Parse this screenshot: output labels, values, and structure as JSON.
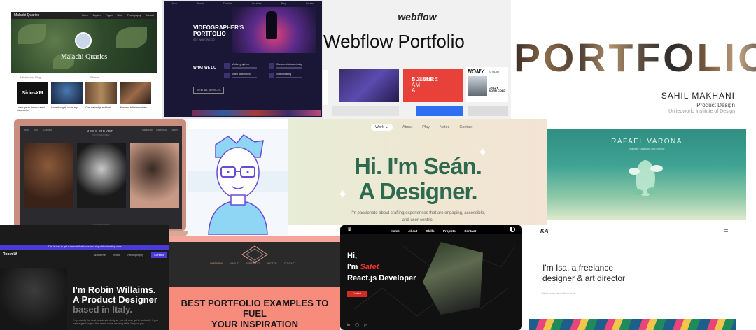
{
  "malachi": {
    "site_name": "Malachi Quaries",
    "nav_links": [
      "Home",
      "Explore",
      "Pages",
      "Work",
      "Photography",
      "Contact"
    ],
    "hero_name": "Malachi Quaries",
    "sub_tabs": [
      "Articles and Vlog",
      "Photos"
    ],
    "thumb_labels": [
      "SiriusXM",
      "",
      "",
      ""
    ],
    "captions": [
      "Lorem ipsum dolor sit amet consectetur",
      "Some thoughts on the trip",
      "Over the bridge and back",
      "Weekend in the mountains"
    ]
  },
  "videographer": {
    "nav_links": [
      "Home",
      "About",
      "Portfolio",
      "Services",
      "Blog",
      "Contact"
    ],
    "title_line1": "VIDEOGRAPHER'S",
    "title_line2": "PORTFOLIO",
    "subtitle": "SEE WHAT WE DO",
    "section": "WHAT WE DO",
    "button": "VIEW ALL SERVICES",
    "services": [
      "Motion graphics",
      "Commercial advertising",
      "Video distribution",
      "Video hosting"
    ]
  },
  "webflow": {
    "logo": "webflow",
    "title": "Webflow Portfolio",
    "shot_text": [
      "I AM A",
      "SIXIMLE",
      "BULSHRE"
    ],
    "brand": "NOMY",
    "brand_suffix": "STUDIO",
    "crazy": [
      "CRAZY",
      "BORN COLD"
    ]
  },
  "sahil": {
    "headline": "PORTFOLIO",
    "name": "SAHIL MAKHANI",
    "role": "Product Design",
    "school": "Unitedworld Institute of Design"
  },
  "jess": {
    "nav_links": [
      "Work",
      "Info",
      "Contact"
    ],
    "name": "JESS MEYER",
    "tagline": "PHOTOGRAPHER",
    "social": [
      "Instagram",
      "Facebook",
      "Twitter"
    ],
    "footer": "© 2024 Jess Meyer"
  },
  "sean": {
    "nav": [
      "Work",
      "About",
      "Play",
      "Notes",
      "Contact"
    ],
    "headline_1": "Hi. I'm Seán.",
    "headline_2": "A Designer.",
    "sub_1": "I'm passionate about crafting experiences that are engaging, accessible,",
    "sub_2": "and user-centric."
  },
  "rafael": {
    "name": "RAFAEL VARONA",
    "subtitle": "Illustrator | Animator | Art Director"
  },
  "robin": {
    "banner": "This is how to get a website that looks amazing without writing code",
    "logo": "Robin.W",
    "nav_links": [
      "About me",
      "Work",
      "Photography"
    ],
    "contact": "Contact",
    "headline_1": "I'm Robin Willaims.",
    "headline_2": "A Product Designer",
    "headline_3": "based in Italy.",
    "para": "I'm probably the most passionate designer you will ever get to work with. If you have a great project that needs some amazing skills, I'm your guy."
  },
  "best": {
    "nav": [
      "OVERVIEW",
      "ABOUT",
      "PORTFOLIO",
      "PHOTOS",
      "CONTACT"
    ],
    "headline_1": "BEST PORTFOLIO EXAMPLES TO FUEL",
    "headline_2": "YOUR INSPIRATION"
  },
  "safet": {
    "nav": [
      "Home",
      "About",
      "Skills",
      "Projects",
      "Contact"
    ],
    "line1": "Hi,",
    "line2_pre": "I'm ",
    "line2_name": "Safet",
    "line3": "React.js Developer",
    "contact": "Contact",
    "social": [
      "in",
      "◯",
      "▷"
    ]
  },
  "isa": {
    "logo": "KA",
    "line1": "I'm Isa, a freelance",
    "line2": "designer & art director",
    "note": "Need some help? Get in touch"
  },
  "colors": {
    "sean_green": "#2e6a50",
    "safet_red": "#e8342f",
    "robin_purple": "#4b3bd6",
    "best_coral": "#f78c7c"
  }
}
